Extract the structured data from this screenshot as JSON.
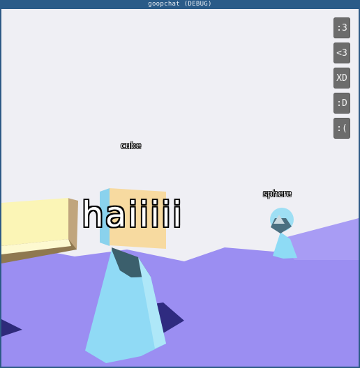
{
  "window": {
    "title": "goopchat (DEBUG)"
  },
  "emotes": [
    {
      "label": ":3"
    },
    {
      "label": "<3"
    },
    {
      "label": "XD"
    },
    {
      "label": ":D"
    },
    {
      "label": ":("
    }
  ],
  "players": [
    {
      "name": "cube",
      "message": "haiiiii"
    },
    {
      "name": "sphere"
    }
  ],
  "colors": {
    "sky": "#efeff4",
    "ground": "#9a8cf0",
    "body": "#8fdcf5",
    "cube_face": "#f6d99a",
    "block": "#fbf5b4"
  }
}
